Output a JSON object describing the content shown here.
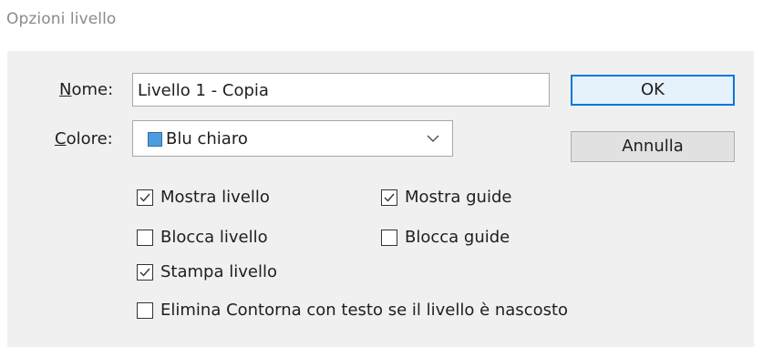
{
  "dialog": {
    "title": "Opzioni livello"
  },
  "fields": {
    "name_label": "Nome:",
    "name_label_mnemonic": "N",
    "name_label_rest": "ome:",
    "name_value": "Livello 1 - Copia",
    "color_label_mnemonic": "C",
    "color_label_rest": "olore:",
    "color_value": "Blu chiaro",
    "color_swatch": "#4d9ce0"
  },
  "buttons": {
    "ok_label": "OK",
    "cancel_label": "Annulla"
  },
  "options": {
    "show_layer": {
      "label": "Mostra livello",
      "checked": true
    },
    "show_guides": {
      "label": "Mostra guide",
      "checked": true
    },
    "lock_layer": {
      "label": "Blocca livello",
      "checked": false
    },
    "lock_guides": {
      "label": "Blocca guide",
      "checked": false
    },
    "print_layer": {
      "label": "Stampa livello",
      "checked": true
    },
    "suppress_text_wrap": {
      "label": "Elimina Contorna con testo se il livello è nascosto",
      "checked": false
    }
  },
  "icons": {
    "checkmark": "checkmark-icon",
    "dropdown": "chevron-down-icon"
  }
}
